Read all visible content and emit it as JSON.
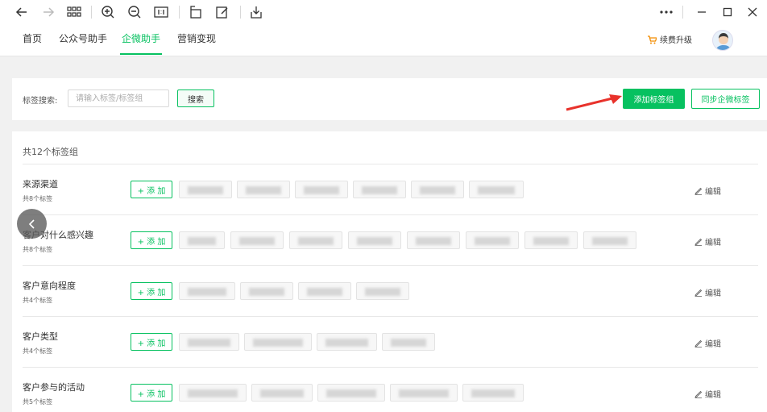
{
  "nav": {
    "tabs": [
      {
        "label": "首页"
      },
      {
        "label": "公众号助手"
      },
      {
        "label": "企微助手"
      },
      {
        "label": "营销变现"
      }
    ],
    "active_index": 2,
    "renew_label": "续费升级"
  },
  "search": {
    "label": "标签搜索:",
    "placeholder": "请输入标签/标签组",
    "button": "搜索",
    "add_group_button": "添加标签组",
    "sync_button": "同步企微标签"
  },
  "list": {
    "count_text": "共12个标签组",
    "add_button": "+ 添 加",
    "edit_label": "编辑",
    "groups": [
      {
        "name": "来源渠道",
        "count": "共8个标签"
      },
      {
        "name": "客户对什么感兴趣",
        "count": "共8个标签"
      },
      {
        "name": "客户意向程度",
        "count": "共4个标签"
      },
      {
        "name": "客户类型",
        "count": "共4个标签"
      },
      {
        "name": "客户参与的活动",
        "count": "共5个标签"
      }
    ]
  },
  "colors": {
    "accent": "#07c160",
    "arrow": "#e8322b"
  }
}
